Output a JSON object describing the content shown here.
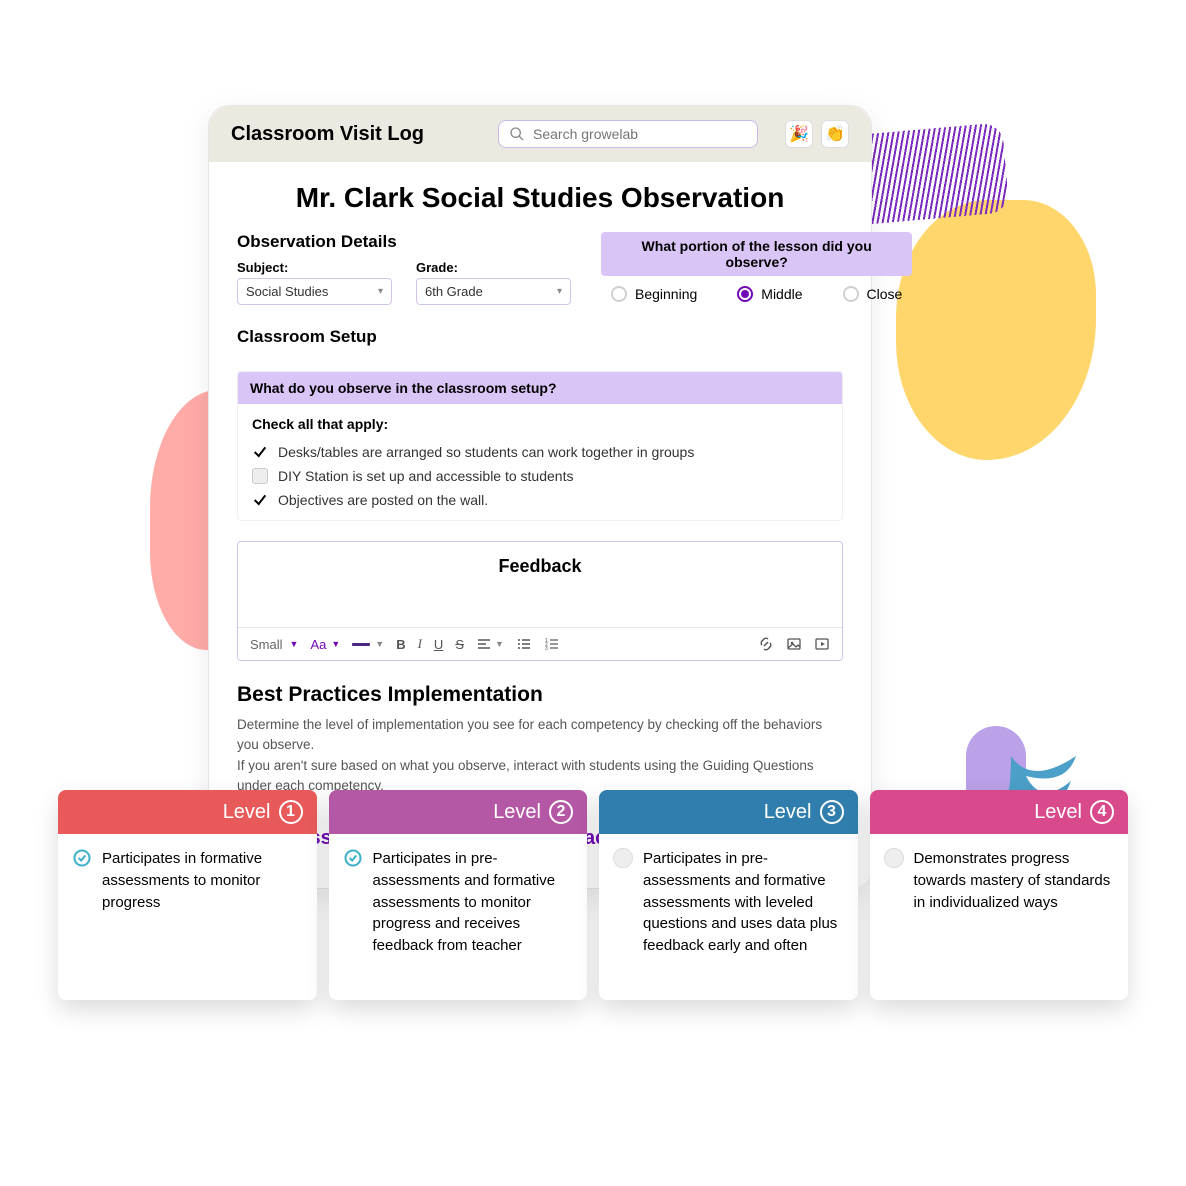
{
  "header": {
    "app_title": "Classroom Visit Log",
    "search_placeholder": "Search growelab"
  },
  "page_title": "Mr. Clark Social Studies Observation",
  "observation_details": {
    "section_title": "Observation Details",
    "subject_label": "Subject:",
    "subject_value": "Social Studies",
    "grade_label": "Grade:",
    "grade_value": "6th Grade"
  },
  "portion": {
    "question": "What portion of the lesson did you observe?",
    "options": [
      "Beginning",
      "Middle",
      "Close"
    ],
    "selected": "Middle"
  },
  "classroom_setup": {
    "section_title": "Classroom Setup",
    "banner": "What do you observe in the classroom setup?",
    "subtitle": "Check all that apply:",
    "items": [
      {
        "label": "Desks/tables are arranged so students can work together in groups",
        "checked": true
      },
      {
        "label": "DIY Station is set up and accessible to students",
        "checked": false
      },
      {
        "label": "Objectives are posted on the wall.",
        "checked": true
      }
    ]
  },
  "feedback": {
    "title": "Feedback",
    "font_label": "Small",
    "font_case": "Aa"
  },
  "best_practices": {
    "title": "Best Practices Implementation",
    "desc_line1": "Determine the level of implementation you see for each competency by checking off the behaviors you observe.",
    "desc_line2": "If you aren't sure based on what you observe, interact with students using the Guiding Questions under each competency.",
    "competency_title": "Assessment, Formative Feedback"
  },
  "levels": [
    {
      "num": "1",
      "color": "#e85a5a",
      "checked": true,
      "label": "Level",
      "text": "Participates in formative assessments to monitor progress"
    },
    {
      "num": "2",
      "color": "#b457a5",
      "checked": true,
      "label": "Level",
      "text": "Participates in pre-assessments and formative assessments to monitor progress and receives feedback from teacher"
    },
    {
      "num": "3",
      "color": "#2f7ead",
      "checked": false,
      "label": "Level",
      "text": "Participates in pre-assessments and formative assessments with leveled questions and uses data plus feedback early and often"
    },
    {
      "num": "4",
      "color": "#d84a8b",
      "checked": false,
      "label": "Level",
      "text": "Demonstrates progress towards mastery of standards in individualized ways"
    }
  ]
}
